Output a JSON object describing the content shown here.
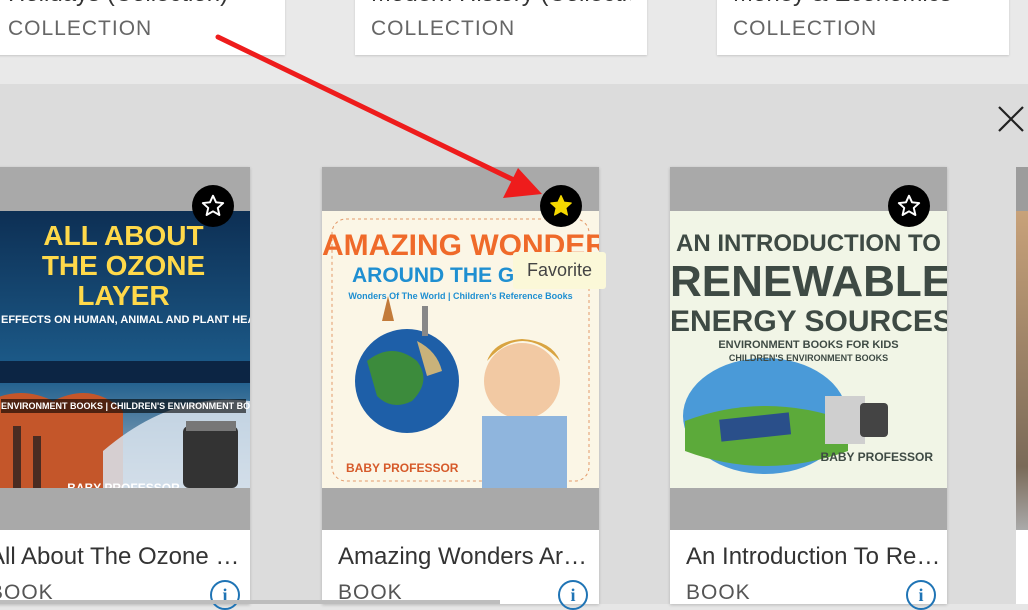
{
  "collections": [
    {
      "title": "Holidays (Collection)",
      "type": "COLLECTION"
    },
    {
      "title": "Modern History (Collection)",
      "type": "COLLECTION"
    },
    {
      "title": "Money & Economics",
      "type": "COLLECTION"
    }
  ],
  "close_label": "Close",
  "tooltip": "Favorite",
  "books": [
    {
      "title": "All About The Ozone Layer",
      "type": "BOOK",
      "favorited": false,
      "cover": {
        "line1": "ALL ABOUT",
        "line2": "THE OZONE LAYER",
        "line3": "EFFECTS ON HUMAN, ANIMAL AND PLANT HEALTH",
        "line4": "ENVIRONMENT BOOKS | CHILDREN'S ENVIRONMENT BOOKS",
        "publisher": "BABY PROFESSOR"
      }
    },
    {
      "title": "Amazing Wonders Around The Globe",
      "type": "BOOK",
      "favorited": true,
      "cover": {
        "line1": "AMAZING WONDERS",
        "line2": "AROUND THE GI",
        "line3": "Wonders Of The World | Children's Reference Books",
        "publisher": "BABY PROFESSOR"
      }
    },
    {
      "title": "An Introduction To Renewable Energy Sources",
      "type": "BOOK",
      "favorited": false,
      "cover": {
        "line1": "AN INTRODUCTION TO",
        "line2": "RENEWABLE",
        "line3": "ENERGY SOURCES",
        "line4": "ENVIRONMENT BOOKS FOR KIDS",
        "line5": "CHILDREN'S ENVIRONMENT BOOKS",
        "publisher": "BABY PROFESSOR"
      }
    }
  ],
  "colors": {
    "accent_arrow": "#ee1c1c",
    "info_blue": "#1f74b5",
    "star_yellow": "#f5d800"
  }
}
